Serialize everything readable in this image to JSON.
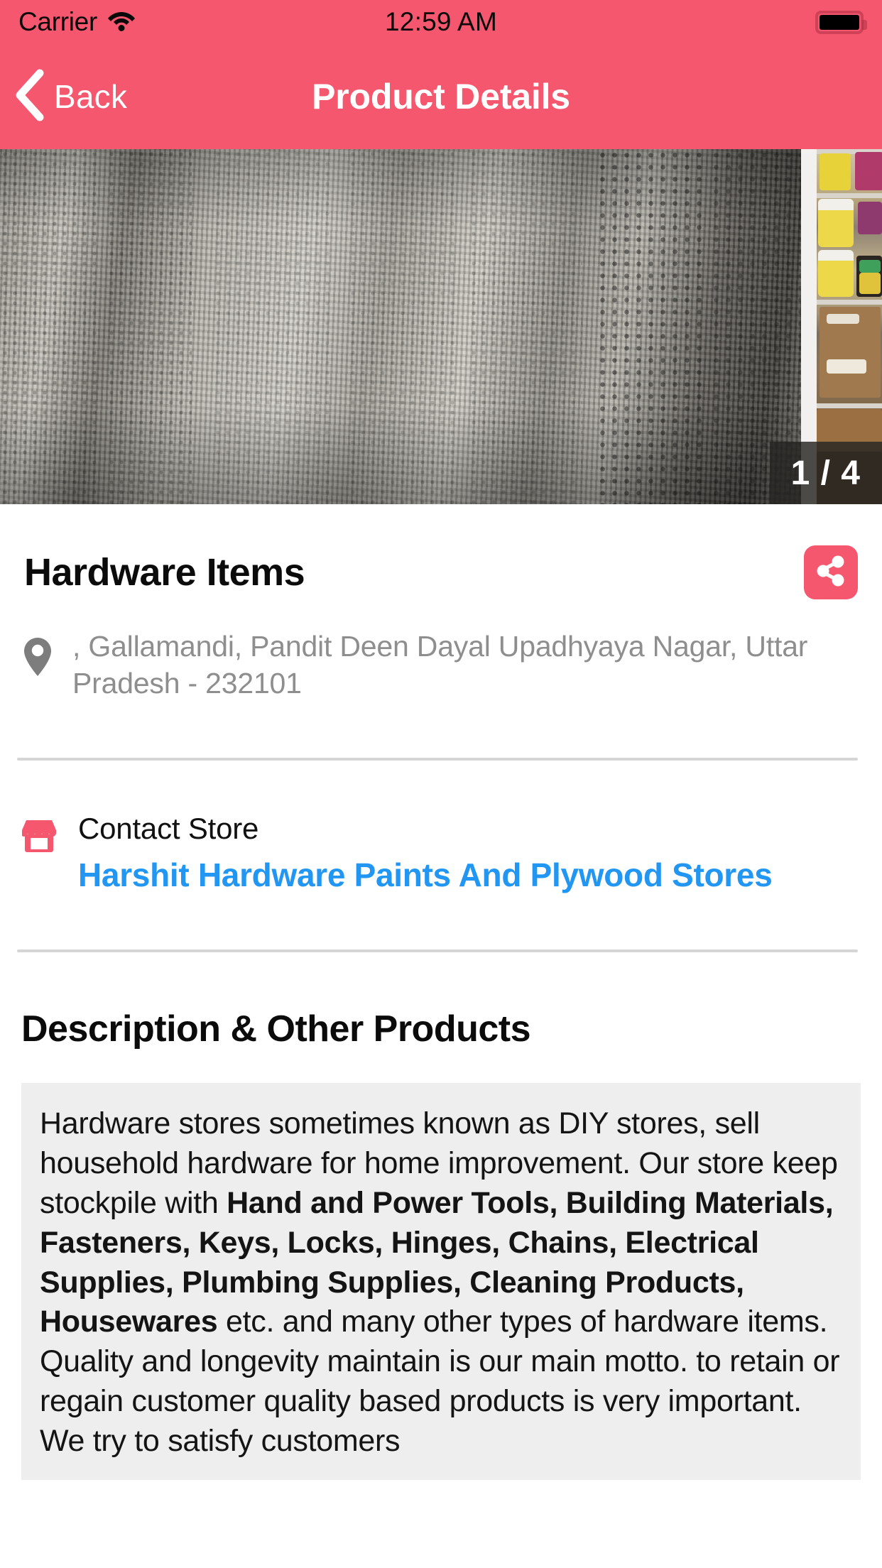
{
  "status_bar": {
    "carrier": "Carrier",
    "time": "12:59 AM",
    "wifi_icon": "wifi-icon",
    "battery_icon": "battery-full-icon"
  },
  "nav": {
    "back_label": "Back",
    "back_icon": "chevron-left-icon",
    "title": "Product Details"
  },
  "gallery": {
    "counter": "1 / 4",
    "current_index": 1,
    "total": 4,
    "main_alt": "rolls of metal wire mesh leaning against wall",
    "next_alt": "store shelves with paint buckets and cardboard boxes"
  },
  "product": {
    "title": "Hardware Items",
    "share_icon": "share-icon",
    "location_icon": "location-pin-icon",
    "address": ", Gallamandi, Pandit Deen Dayal Upadhyaya Nagar, Uttar Pradesh - 232101"
  },
  "contact": {
    "store_icon": "storefront-icon",
    "label": "Contact Store",
    "store_name": "Harshit Hardware Paints And Plywood Stores"
  },
  "description": {
    "heading": "Description & Other Products",
    "paragraph_parts": [
      {
        "text": "Hardware stores sometimes known as DIY stores, sell household hardware for home improvement. Our store keep stockpile with ",
        "bold": false
      },
      {
        "text": "Hand and Power Tools, Building Materials, Fasteners, Keys, Locks, Hinges, Chains, Electrical Supplies, Plumbing Supplies, Cleaning Products, Housewares",
        "bold": true
      },
      {
        "text": " etc. and many other types of hardware items. Quality and longevity maintain is our main motto. to retain or regain customer quality based products is very important. We try to satisfy customers",
        "bold": false
      }
    ]
  },
  "colors": {
    "accent": "#f5576e",
    "link": "#2196f3",
    "muted_text": "#8e8e8e",
    "divider": "#d6d6d6",
    "desc_background": "#eeeeee"
  }
}
